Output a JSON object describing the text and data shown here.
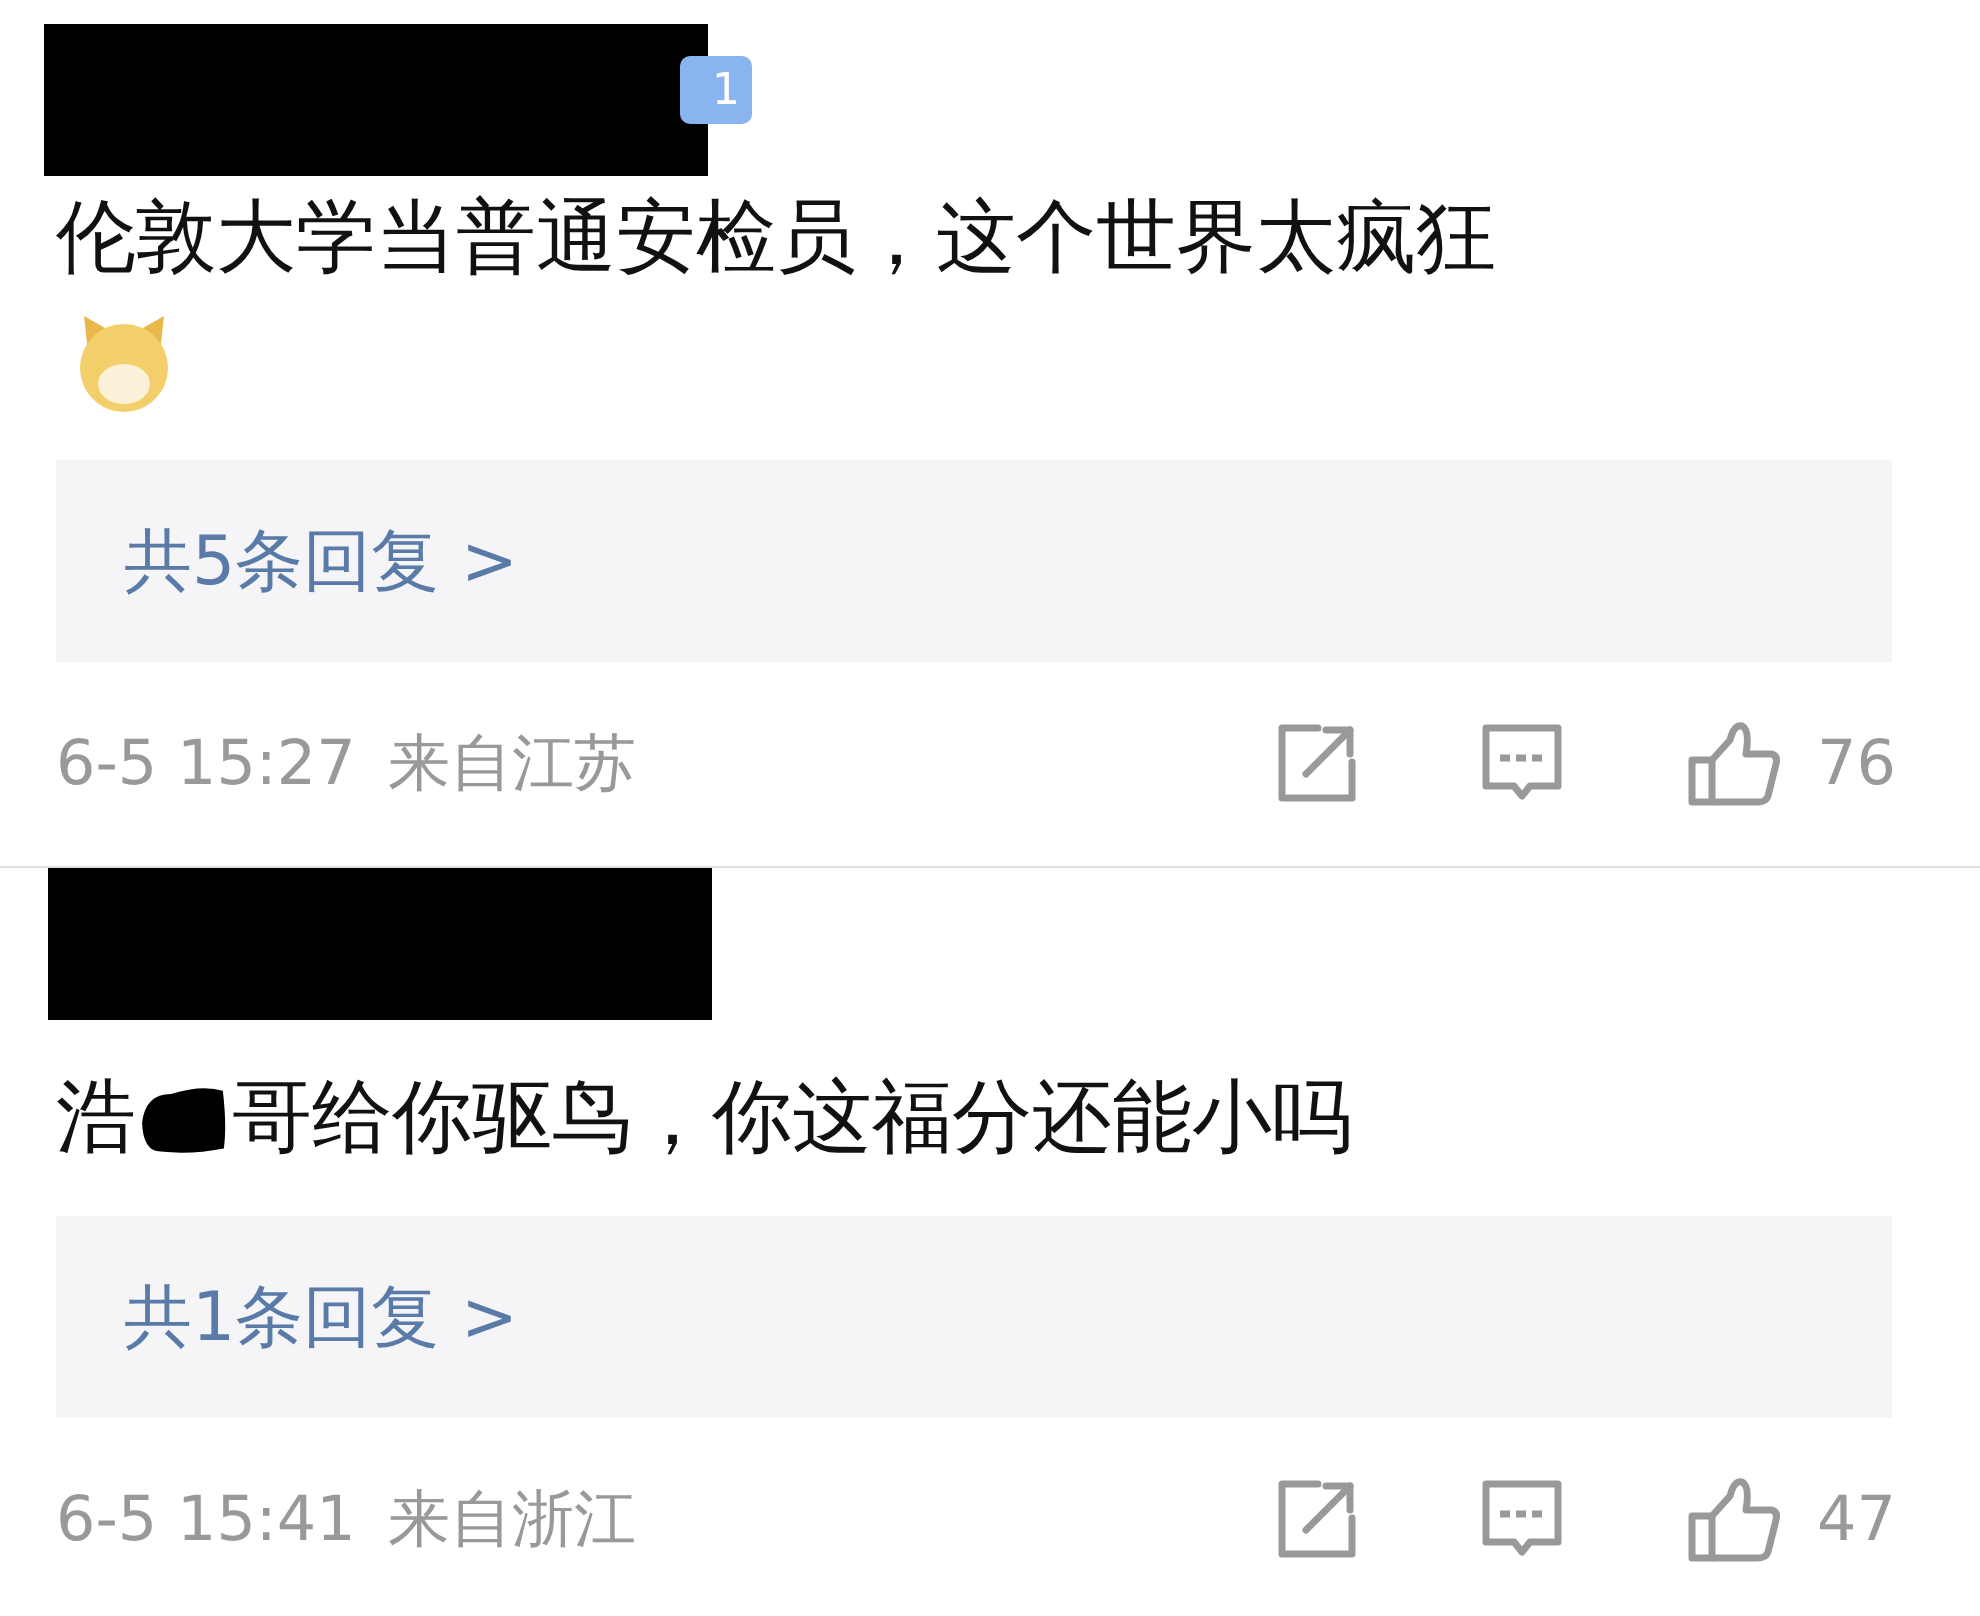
{
  "comments": [
    {
      "badge": "1",
      "body": [
        {
          "kind": "text",
          "text": "伦敦大学当普通安检员，这个世界太疯狂"
        },
        {
          "kind": "emoji"
        }
      ],
      "replies": "共5条回复 >",
      "time": "6-5 15:27",
      "location": "来自江苏",
      "likes": "76"
    },
    {
      "body": [
        {
          "kind": "text",
          "text": "浩"
        },
        {
          "kind": "scribble"
        },
        {
          "kind": "text",
          "text": "哥给你驱鸟，你这福分还能小吗"
        }
      ],
      "replies": "共1条回复 >",
      "time": "6-5 15:41",
      "location": "来自浙江",
      "likes": "47"
    }
  ]
}
